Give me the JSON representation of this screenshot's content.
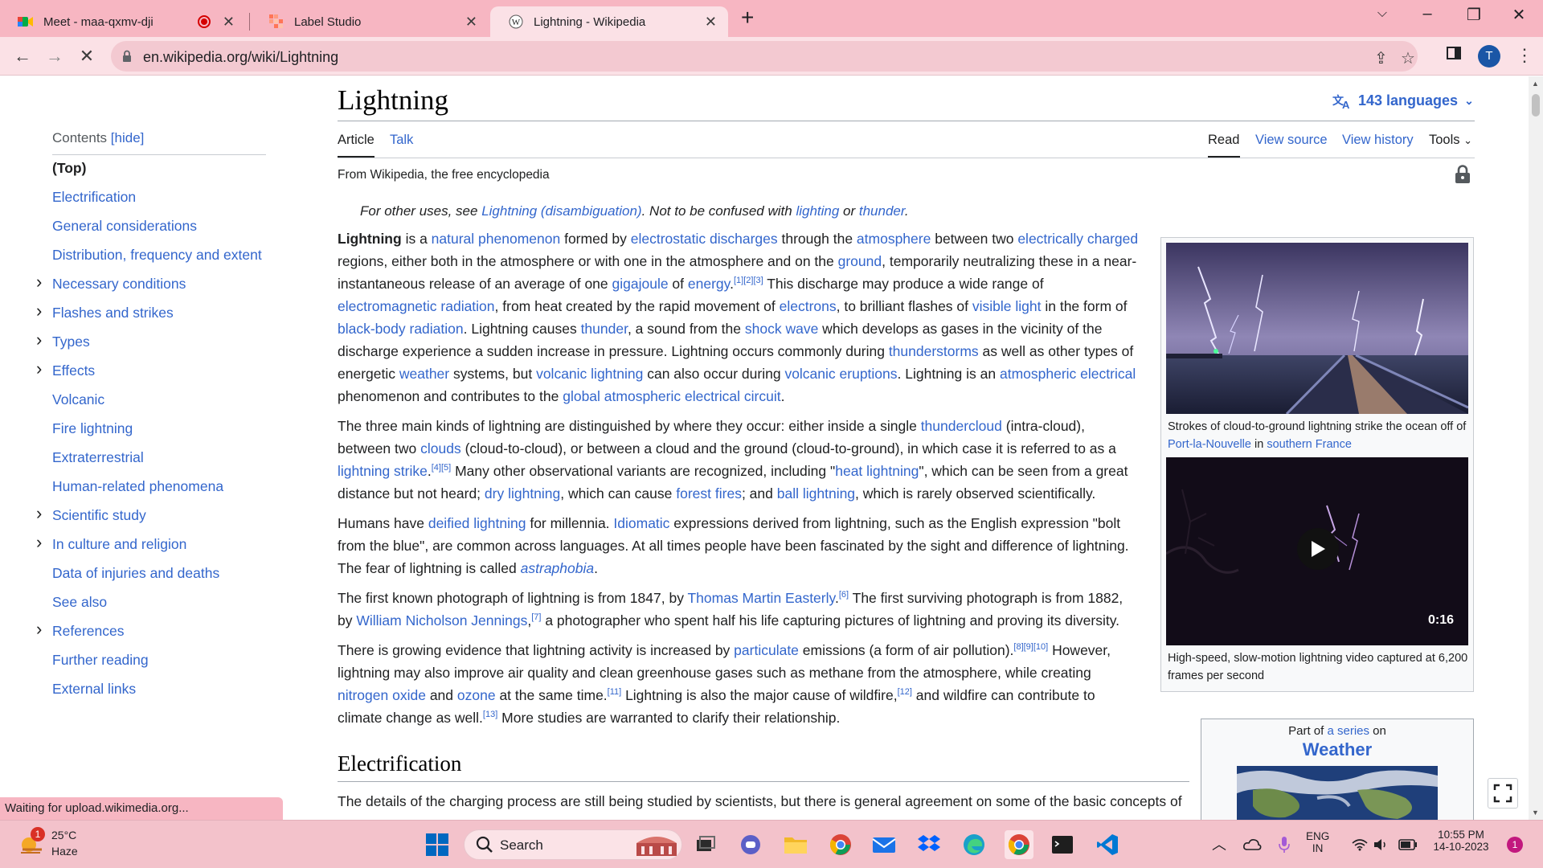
{
  "browser": {
    "tabs": [
      {
        "title": "Meet - maa-qxmv-dji",
        "active": false
      },
      {
        "title": "Label Studio",
        "active": false
      },
      {
        "title": "Lightning - Wikipedia",
        "active": true
      }
    ],
    "new_tab": "+",
    "url": "en.wikipedia.org/wiki/Lightning",
    "profile_initial": "T",
    "status_text": "Waiting for upload.wikimedia.org..."
  },
  "article": {
    "title": "Lightning",
    "languages": "143 languages",
    "tabs": {
      "article": "Article",
      "talk": "Talk",
      "read": "Read",
      "view_source": "View source",
      "view_history": "View history",
      "tools": "Tools"
    },
    "from": "From Wikipedia, the free encyclopedia",
    "hatnote": {
      "pre": "For other uses, see ",
      "link1": "Lightning (disambiguation)",
      "mid": ". Not to be confused with ",
      "link2": "lighting",
      "or": " or ",
      "link3": "thunder",
      "post": "."
    },
    "section_heading": "Electrification",
    "section_text": "The details of the charging process are still being studied by scientists, but there is general agreement on some of the basic concepts of"
  },
  "toc": {
    "title": "Contents",
    "hide": "[hide]",
    "items": [
      {
        "label": "(Top)",
        "expandable": false
      },
      {
        "label": "Electrification",
        "expandable": false
      },
      {
        "label": "General considerations",
        "expandable": false
      },
      {
        "label": "Distribution, frequency and extent",
        "expandable": false
      },
      {
        "label": "Necessary conditions",
        "expandable": true
      },
      {
        "label": "Flashes and strikes",
        "expandable": true
      },
      {
        "label": "Types",
        "expandable": true
      },
      {
        "label": "Effects",
        "expandable": true
      },
      {
        "label": "Volcanic",
        "expandable": false
      },
      {
        "label": "Fire lightning",
        "expandable": false
      },
      {
        "label": "Extraterrestrial",
        "expandable": false
      },
      {
        "label": "Human-related phenomena",
        "expandable": false
      },
      {
        "label": "Scientific study",
        "expandable": true
      },
      {
        "label": "In culture and religion",
        "expandable": true
      },
      {
        "label": "Data of injuries and deaths",
        "expandable": false
      },
      {
        "label": "See also",
        "expandable": false
      },
      {
        "label": "References",
        "expandable": true
      },
      {
        "label": "Further reading",
        "expandable": false
      },
      {
        "label": "External links",
        "expandable": false
      }
    ]
  },
  "paragraphs": [
    [
      {
        "b": "Lightning"
      },
      {
        "t": " is a "
      },
      {
        "a": "natural phenomenon"
      },
      {
        "t": " formed by "
      },
      {
        "a": "electrostatic discharges"
      },
      {
        "t": " through the "
      },
      {
        "a": "atmosphere"
      },
      {
        "t": " between two "
      },
      {
        "a": "electrically charged"
      },
      {
        "t": " regions, either both in the atmosphere or with one in the atmosphere and on the "
      },
      {
        "a": "ground"
      },
      {
        "t": ", temporarily neutralizing these in a near-instantaneous release of an average of one "
      },
      {
        "a": "gigajoule"
      },
      {
        "t": " of "
      },
      {
        "a": "energy"
      },
      {
        "t": "."
      },
      {
        "s": "[1][2][3]"
      },
      {
        "t": " This discharge may produce a wide range of "
      },
      {
        "a": "electromagnetic radiation"
      },
      {
        "t": ", from heat created by the rapid movement of "
      },
      {
        "a": "electrons"
      },
      {
        "t": ", to brilliant flashes of "
      },
      {
        "a": "visible light"
      },
      {
        "t": " in the form of "
      },
      {
        "a": "black-body radiation"
      },
      {
        "t": ". Lightning causes "
      },
      {
        "a": "thunder"
      },
      {
        "t": ", a sound from the "
      },
      {
        "a": "shock wave"
      },
      {
        "t": " which develops as gases in the vicinity of the discharge experience a sudden increase in pressure. Lightning occurs commonly during "
      },
      {
        "a": "thunderstorms"
      },
      {
        "t": " as well as other types of energetic "
      },
      {
        "a": "weather"
      },
      {
        "t": " systems, but "
      },
      {
        "a": "volcanic lightning"
      },
      {
        "t": " can also occur during "
      },
      {
        "a": "volcanic eruptions"
      },
      {
        "t": ". Lightning is an "
      },
      {
        "a": "atmospheric electrical"
      },
      {
        "t": " phenomenon and contributes to the "
      },
      {
        "a": "global atmospheric electrical circuit"
      },
      {
        "t": "."
      }
    ],
    [
      {
        "t": "The three main kinds of lightning are distinguished by where they occur: either inside a single "
      },
      {
        "a": "thundercloud"
      },
      {
        "t": " (intra-cloud), between two "
      },
      {
        "a": "clouds"
      },
      {
        "t": " (cloud-to-cloud), or between a cloud and the ground (cloud-to-ground), in which case it is referred to as a "
      },
      {
        "a": "lightning strike"
      },
      {
        "t": "."
      },
      {
        "s": "[4][5]"
      },
      {
        "t": " Many other observational variants are recognized, including \""
      },
      {
        "a": "heat lightning"
      },
      {
        "t": "\", which can be seen from a great distance but not heard; "
      },
      {
        "a": "dry lightning"
      },
      {
        "t": ", which can cause "
      },
      {
        "a": "forest fires"
      },
      {
        "t": "; and "
      },
      {
        "a": "ball lightning"
      },
      {
        "t": ", which is rarely observed scientifically."
      }
    ],
    [
      {
        "t": "Humans have "
      },
      {
        "a": "deified lightning"
      },
      {
        "t": " for millennia. "
      },
      {
        "a": "Idiomatic"
      },
      {
        "t": " expressions derived from lightning, such as the English expression \"bolt from the blue\", are common across languages. At all times people have been fascinated by the sight and difference of lightning. The fear of lightning is called "
      },
      {
        "ai": "astraphobia"
      },
      {
        "t": "."
      }
    ],
    [
      {
        "t": "The first known photograph of lightning is from 1847, by "
      },
      {
        "a": "Thomas Martin Easterly"
      },
      {
        "t": "."
      },
      {
        "s": "[6]"
      },
      {
        "t": " The first surviving photograph is from 1882, by "
      },
      {
        "a": "William Nicholson Jennings"
      },
      {
        "t": ","
      },
      {
        "s": "[7]"
      },
      {
        "t": " a photographer who spent half his life capturing pictures of lightning and proving its diversity."
      }
    ],
    [
      {
        "t": "There is growing evidence that lightning activity is increased by "
      },
      {
        "a": "particulate"
      },
      {
        "t": " emissions (a form of air pollution)."
      },
      {
        "s": "[8][9][10]"
      },
      {
        "t": " However, lightning may also improve air quality and clean greenhouse gases such as methane from the atmosphere, while creating "
      },
      {
        "a": "nitrogen oxide"
      },
      {
        "t": " and "
      },
      {
        "a": "ozone"
      },
      {
        "t": " at the same time."
      },
      {
        "s": "[11]"
      },
      {
        "t": " Lightning is also the major cause of wildfire,"
      },
      {
        "s": "[12]"
      },
      {
        "t": " and wildfire can contribute to climate change as well."
      },
      {
        "s": "[13]"
      },
      {
        "t": " More studies are warranted to clarify their relationship."
      }
    ]
  ],
  "infobox": {
    "caption1": [
      {
        "t": "Strokes of cloud-to-ground lightning strike the ocean off of "
      },
      {
        "a": "Port-la-Nouvelle"
      },
      {
        "t": " in "
      },
      {
        "a": "southern France"
      }
    ],
    "video_duration": "0:16",
    "caption2": "High-speed, slow-motion lightning video captured at 6,200 frames per second"
  },
  "series_box": {
    "pre": "Part of ",
    "link": "a series",
    "post": " on",
    "name": "Weather"
  },
  "taskbar": {
    "weather_temp": "25°C",
    "weather_desc": "Haze",
    "weather_badge": "1",
    "search_label": "Search",
    "lang_line1": "ENG",
    "lang_line2": "IN",
    "time": "10:55 PM",
    "date": "14-10-2023",
    "notif_count": "1"
  },
  "colors": {
    "link": "#3366cc",
    "tabbar": "#f7b6c2",
    "toolbar": "#fbe1e6",
    "taskbar": "#f3c2cb"
  }
}
